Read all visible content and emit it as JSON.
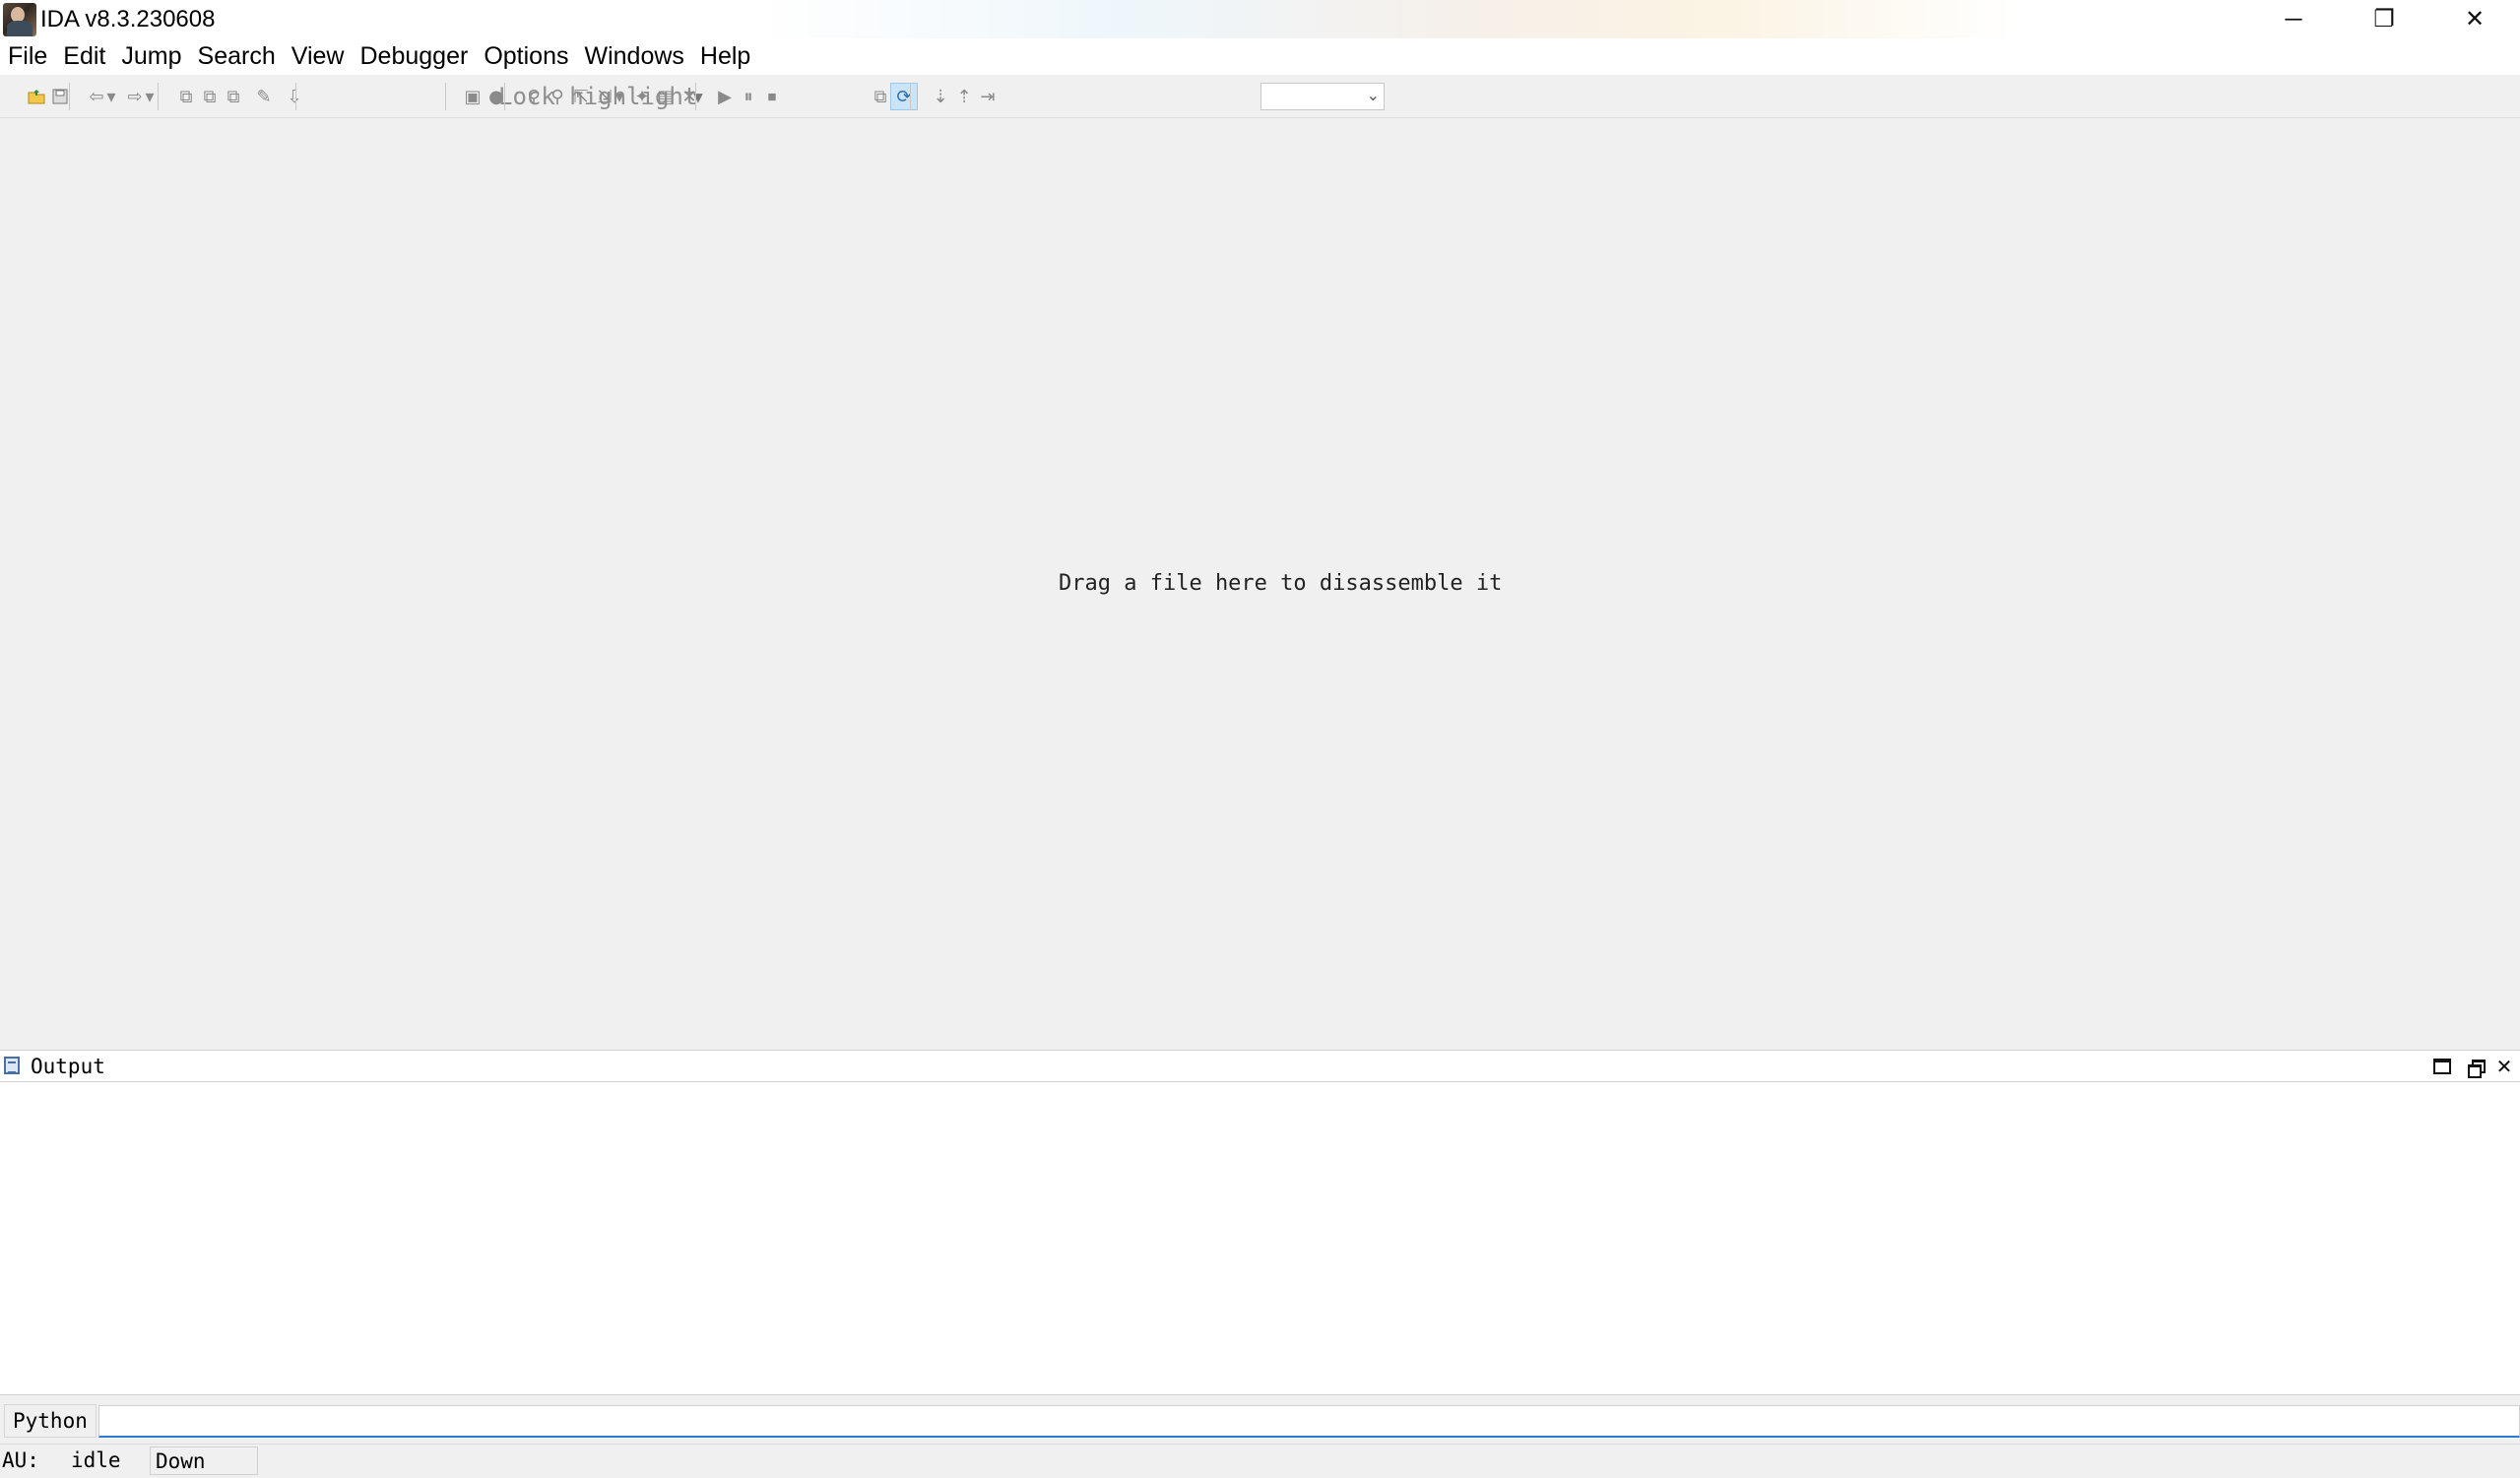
{
  "window": {
    "title": "IDA v8.3.230608",
    "minimize_glyph": "─",
    "restore_glyph": "❐",
    "close_glyph": "✕"
  },
  "menu": [
    "File",
    "Edit",
    "Jump",
    "Search",
    "View",
    "Debugger",
    "Options",
    "Windows",
    "Help"
  ],
  "toolbar": {
    "lock_highlight_label": "Lock highlight",
    "debugger_selected": "",
    "icons": {
      "open": "open-folder-icon",
      "save": "save-icon",
      "back": "back-arrow-icon",
      "forward": "forward-arrow-icon",
      "run": "play-icon",
      "pause": "pause-icon",
      "stop": "stop-icon"
    }
  },
  "main": {
    "drag_hint": "Drag a file here to disassemble it"
  },
  "output": {
    "title": "Output",
    "content": ""
  },
  "cli": {
    "language_button": "Python",
    "value": ""
  },
  "status": {
    "au_label": "AU:",
    "au_state": "idle",
    "direction": "Down"
  },
  "colors": {
    "accent_blue": "#2b7bd0",
    "toolbar_active_bg": "#cce4f7",
    "background": "#f0f0f0"
  }
}
